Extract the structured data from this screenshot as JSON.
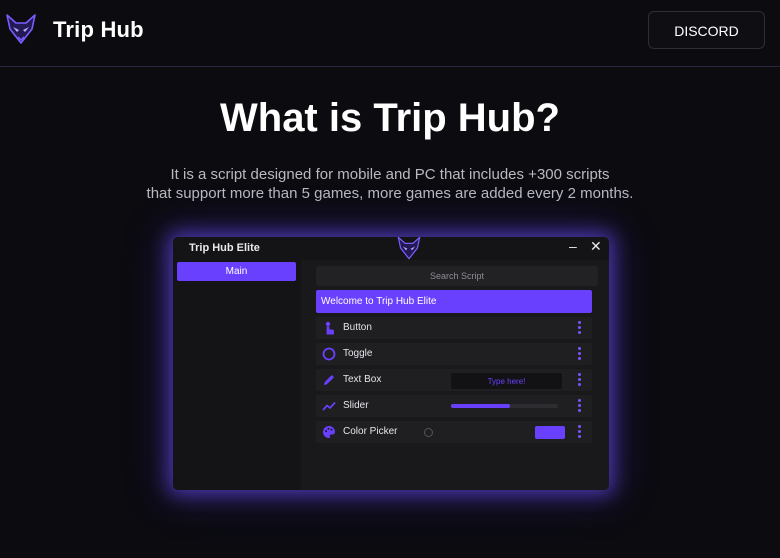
{
  "header": {
    "brand_name": "Trip Hub",
    "brand_logo": "fox-icon",
    "discord_label": "DISCORD"
  },
  "hero": {
    "title": "What is Trip Hub?",
    "subtitle_line1": "It is a script designed for mobile and PC that includes +300 scripts",
    "subtitle_line2": "that support more than 5 games, more games are added every 2 months."
  },
  "window": {
    "title": "Trip Hub Elite",
    "logo": "fox-icon",
    "minimize_label": "–",
    "close_label": "✕",
    "sidebar_tabs": [
      {
        "label": "Main"
      }
    ],
    "search_placeholder": "Search Script",
    "welcome_text": "Welcome to Trip Hub Elite",
    "rows": [
      {
        "label": "Button",
        "icon": "touch-icon"
      },
      {
        "label": "Toggle",
        "icon": "circle-icon"
      },
      {
        "label": "Text Box",
        "icon": "pencil-icon",
        "placeholder": "Type here!"
      },
      {
        "label": "Slider",
        "icon": "trend-icon",
        "value": 0.55
      },
      {
        "label": "Color Picker",
        "icon": "palette-icon",
        "color": "#6a40ff"
      }
    ]
  },
  "colors": {
    "accent": "#6a40ff",
    "background": "#0b0b10"
  }
}
